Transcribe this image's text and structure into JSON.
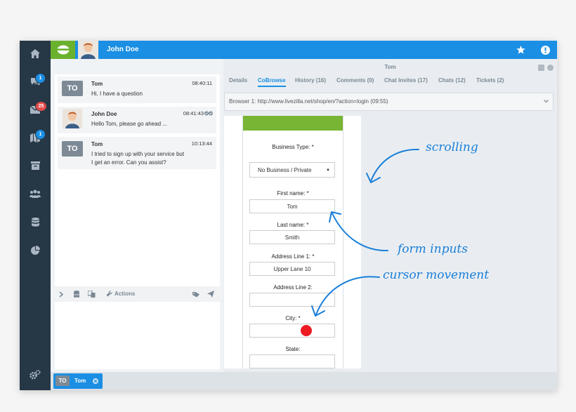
{
  "topbar": {
    "operator_name": "John Doe"
  },
  "sidebar": {
    "items": [
      {
        "icon": "home-icon"
      },
      {
        "icon": "chats-icon",
        "badge": "1",
        "badge_color": "#1a8fe3"
      },
      {
        "icon": "tickets-icon",
        "badge": "25",
        "badge_color": "#e34a4a"
      },
      {
        "icon": "map-icon",
        "badge": "1",
        "badge_color": "#1a8fe3"
      },
      {
        "icon": "archive-icon"
      },
      {
        "icon": "users-icon"
      },
      {
        "icon": "database-icon"
      },
      {
        "icon": "reports-icon"
      }
    ],
    "settings_icon": "gear-icon"
  },
  "chat": {
    "messages": [
      {
        "sender": "Tom",
        "initials": "TO",
        "time": "08:40:11",
        "text": "Hi, I have a question"
      },
      {
        "sender": "John Doe",
        "initials": "",
        "time": "08:41:43",
        "text": "Hello Tom, please go ahead ..."
      },
      {
        "sender": "Tom",
        "initials": "TO",
        "time": "10:13:44",
        "text_line1": "I tried to sign up with your service but",
        "text_line2": "I get an error. Can you assist?"
      }
    ],
    "toolbar": {
      "actions_label": "Actions"
    }
  },
  "right": {
    "title": "Tom",
    "tabs": [
      "Details",
      "CoBrowse",
      "History (16)",
      "Comments (0)",
      "Chat Invites (17)",
      "Chats (12)",
      "Tickets (2)"
    ],
    "active_tab": "CoBrowse",
    "url_bar": "Browser 1: http://www.livezilla.net/shop/en/?action=login (09:55)"
  },
  "form": {
    "business_type_label": "Business Type: *",
    "business_type_value": "No Business / Private",
    "first_name_label": "First name: *",
    "first_name_value": "Tom",
    "last_name_label": "Last name: *",
    "last_name_value": "Smith",
    "address1_label": "Address Line 1: *",
    "address1_value": "Upper Lane 10",
    "address2_label": "Address Line 2:",
    "address2_value": "",
    "city_label": "City: *",
    "city_value": "",
    "state_label": "State:",
    "state_value": ""
  },
  "annotations": {
    "scrolling": "scrolling",
    "form_inputs": "form inputs",
    "cursor_movement": "cursor movement"
  },
  "bottom_tab": {
    "initials": "TO",
    "name": "Tom"
  },
  "colors": {
    "accent": "#1a8fe3",
    "brand_green": "#6ab22e",
    "sidebar": "#263746",
    "cursor": "#ee1b22"
  }
}
